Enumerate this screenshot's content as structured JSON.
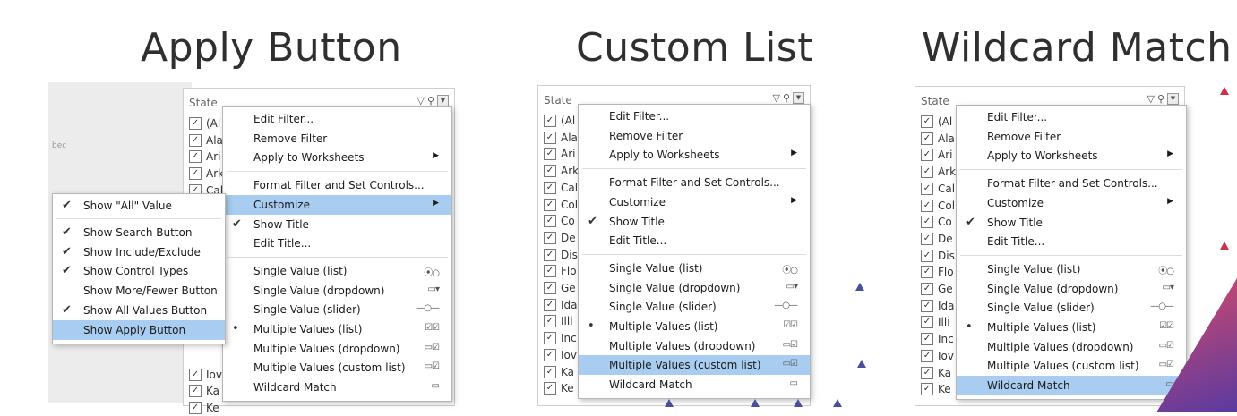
{
  "panels": [
    {
      "title": "Apply Button",
      "filter": {
        "name": "State",
        "rows": [
          "(Al",
          "Ala",
          "Ari",
          "Ark",
          "Cal",
          "",
          "",
          "",
          "",
          "",
          "",
          "",
          "",
          "",
          "",
          "Iov",
          "Ka",
          "Ke"
        ]
      },
      "menu": [
        {
          "label": "Edit Filter...",
          "check": "",
          "right": ""
        },
        {
          "label": "Remove Filter",
          "check": "",
          "right": ""
        },
        {
          "label": "Apply to Worksheets",
          "check": "",
          "right": "▶"
        },
        {
          "sep": true
        },
        {
          "label": "Format Filter and Set Controls...",
          "check": "",
          "right": ""
        },
        {
          "label": "Customize",
          "check": "",
          "right": "▶",
          "hl": true
        },
        {
          "label": "Show Title",
          "check": "✔",
          "right": ""
        },
        {
          "label": "Edit Title...",
          "check": "",
          "right": ""
        },
        {
          "sep": true
        },
        {
          "label": "Single Value (list)",
          "check": "",
          "right": "⦿○"
        },
        {
          "label": "Single Value (dropdown)",
          "check": "",
          "right": "▭▾"
        },
        {
          "label": "Single Value (slider)",
          "check": "",
          "right": "—○—"
        },
        {
          "label": "Multiple Values (list)",
          "check": "•",
          "right": "☑☑"
        },
        {
          "label": "Multiple Values (dropdown)",
          "check": "",
          "right": "▭☑"
        },
        {
          "label": "Multiple Values (custom list)",
          "check": "",
          "right": "▭☑"
        },
        {
          "label": "Wildcard Match",
          "check": "",
          "right": "▭"
        }
      ],
      "submenu": [
        {
          "label": "Show \"All\" Value",
          "check": "✔"
        },
        {
          "sep": true
        },
        {
          "label": "Show Search Button",
          "check": "✔"
        },
        {
          "label": "Show Include/Exclude",
          "check": "✔"
        },
        {
          "label": "Show Control Types",
          "check": "✔"
        },
        {
          "label": "Show More/Fewer Button",
          "check": ""
        },
        {
          "label": "Show All Values Button",
          "check": "✔"
        },
        {
          "label": "Show Apply Button",
          "check": "",
          "hl": true
        }
      ],
      "map_label": "bec"
    },
    {
      "title": "Custom List",
      "filter": {
        "name": "State",
        "rows": [
          "(Al",
          "Ala",
          "Ari",
          "Ark",
          "Cal",
          "Col",
          "Co",
          "De",
          "Dis",
          "Flo",
          "Ge",
          "Ida",
          "Illi",
          "Inc",
          "Iov",
          "Ka",
          "Ke"
        ]
      },
      "menu": [
        {
          "label": "Edit Filter...",
          "check": "",
          "right": ""
        },
        {
          "label": "Remove Filter",
          "check": "",
          "right": ""
        },
        {
          "label": "Apply to Worksheets",
          "check": "",
          "right": "▶"
        },
        {
          "sep": true
        },
        {
          "label": "Format Filter and Set Controls...",
          "check": "",
          "right": ""
        },
        {
          "label": "Customize",
          "check": "",
          "right": "▶"
        },
        {
          "label": "Show Title",
          "check": "✔",
          "right": ""
        },
        {
          "label": "Edit Title...",
          "check": "",
          "right": ""
        },
        {
          "sep": true
        },
        {
          "label": "Single Value (list)",
          "check": "",
          "right": "⦿○"
        },
        {
          "label": "Single Value (dropdown)",
          "check": "",
          "right": "▭▾"
        },
        {
          "label": "Single Value (slider)",
          "check": "",
          "right": "—○—"
        },
        {
          "label": "Multiple Values (list)",
          "check": "•",
          "right": "☑☑"
        },
        {
          "label": "Multiple Values (dropdown)",
          "check": "",
          "right": "▭☑"
        },
        {
          "label": "Multiple Values (custom list)",
          "check": "",
          "right": "▭☑",
          "hl": true
        },
        {
          "label": "Wildcard Match",
          "check": "",
          "right": "▭"
        }
      ]
    },
    {
      "title": "Wildcard Match",
      "filter": {
        "name": "State",
        "rows": [
          "(Al",
          "Ala",
          "Ari",
          "Ark",
          "Cal",
          "Col",
          "Co",
          "De",
          "Dis",
          "Flo",
          "Ge",
          "Ida",
          "Illi",
          "Inc",
          "Iov",
          "Ka",
          "Ke"
        ]
      },
      "menu": [
        {
          "label": "Edit Filter...",
          "check": "",
          "right": ""
        },
        {
          "label": "Remove Filter",
          "check": "",
          "right": ""
        },
        {
          "label": "Apply to Worksheets",
          "check": "",
          "right": "▶"
        },
        {
          "sep": true
        },
        {
          "label": "Format Filter and Set Controls...",
          "check": "",
          "right": ""
        },
        {
          "label": "Customize",
          "check": "",
          "right": "▶"
        },
        {
          "label": "Show Title",
          "check": "✔",
          "right": ""
        },
        {
          "label": "Edit Title...",
          "check": "",
          "right": ""
        },
        {
          "sep": true
        },
        {
          "label": "Single Value (list)",
          "check": "",
          "right": "⦿○"
        },
        {
          "label": "Single Value (dropdown)",
          "check": "",
          "right": "▭▾"
        },
        {
          "label": "Single Value (slider)",
          "check": "",
          "right": "—○—"
        },
        {
          "label": "Multiple Values (list)",
          "check": "•",
          "right": "☑☑"
        },
        {
          "label": "Multiple Values (dropdown)",
          "check": "",
          "right": "▭☑"
        },
        {
          "label": "Multiple Values (custom list)",
          "check": "",
          "right": "▭☑"
        },
        {
          "label": "Wildcard Match",
          "check": "",
          "right": "▭",
          "hl": true
        }
      ]
    }
  ],
  "colors": {
    "highlight": "#a8cdf0",
    "accent_blue": "#4a4f9c",
    "accent_pink": "#c8344c"
  }
}
